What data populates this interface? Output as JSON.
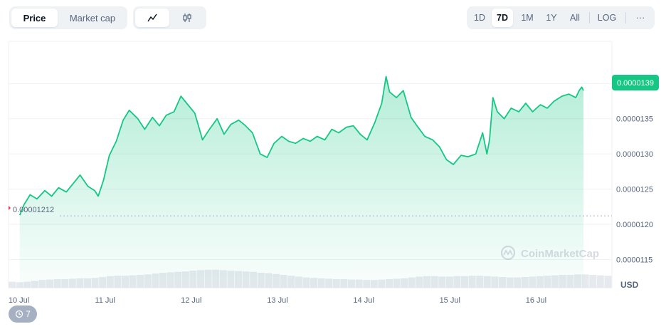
{
  "toolbar": {
    "view_tabs": [
      {
        "label": "Price",
        "active": true
      },
      {
        "label": "Market cap",
        "active": false
      }
    ],
    "chart_types": [
      {
        "icon": "line-chart-icon",
        "active": true
      },
      {
        "icon": "candlestick-icon",
        "active": false
      }
    ],
    "ranges": [
      {
        "label": "1D",
        "active": false
      },
      {
        "label": "7D",
        "active": true
      },
      {
        "label": "1M",
        "active": false
      },
      {
        "label": "1Y",
        "active": false
      },
      {
        "label": "All",
        "active": false
      }
    ],
    "log_label": "LOG",
    "more_label": "···"
  },
  "badge": {
    "icon": "history-icon",
    "count": "7"
  },
  "watermark": "CoinMarketCap",
  "colors": {
    "line": "#16c784",
    "area": "#16c784",
    "current_badge": "#16c784",
    "start_marker": "#ea3943",
    "grid": "#eff2f5"
  },
  "chart_data": {
    "type": "area",
    "currency_label": "USD",
    "x_tick_labels": [
      "10 Jul",
      "11 Jul",
      "12 Jul",
      "13 Jul",
      "14 Jul",
      "15 Jul",
      "16 Jul"
    ],
    "y_tick_labels": [
      "0.0000115",
      "0.0000120",
      "0.0000125",
      "0.0000130",
      "0.0000135"
    ],
    "y_ticks": [
      1.15e-05,
      1.2e-05,
      1.25e-05,
      1.3e-05,
      1.35e-05
    ],
    "ylim": [
      1.11e-05,
      1.46e-05
    ],
    "xlim": [
      0,
      7
    ],
    "start_value": 1.212e-05,
    "start_label": "0.00001212",
    "current_value": 1.39e-05,
    "current_label": "0.0000139",
    "grid": true,
    "series": [
      {
        "points": [
          [
            0.13,
            1.213e-05
          ],
          [
            0.18,
            1.228e-05
          ],
          [
            0.25,
            1.242e-05
          ],
          [
            0.33,
            1.236e-05
          ],
          [
            0.42,
            1.248e-05
          ],
          [
            0.5,
            1.24e-05
          ],
          [
            0.58,
            1.252e-05
          ],
          [
            0.67,
            1.246e-05
          ],
          [
            0.75,
            1.258e-05
          ],
          [
            0.83,
            1.27e-05
          ],
          [
            0.92,
            1.254e-05
          ],
          [
            1.0,
            1.248e-05
          ],
          [
            1.04,
            1.24e-05
          ],
          [
            1.1,
            1.262e-05
          ],
          [
            1.17,
            1.298e-05
          ],
          [
            1.25,
            1.318e-05
          ],
          [
            1.33,
            1.348e-05
          ],
          [
            1.4,
            1.362e-05
          ],
          [
            1.5,
            1.35e-05
          ],
          [
            1.58,
            1.335e-05
          ],
          [
            1.67,
            1.352e-05
          ],
          [
            1.75,
            1.34e-05
          ],
          [
            1.83,
            1.355e-05
          ],
          [
            1.92,
            1.36e-05
          ],
          [
            2.0,
            1.382e-05
          ],
          [
            2.08,
            1.37e-05
          ],
          [
            2.16,
            1.358e-05
          ],
          [
            2.25,
            1.32e-05
          ],
          [
            2.33,
            1.335e-05
          ],
          [
            2.42,
            1.35e-05
          ],
          [
            2.5,
            1.328e-05
          ],
          [
            2.58,
            1.342e-05
          ],
          [
            2.67,
            1.348e-05
          ],
          [
            2.75,
            1.34e-05
          ],
          [
            2.83,
            1.33e-05
          ],
          [
            2.92,
            1.3e-05
          ],
          [
            3.0,
            1.295e-05
          ],
          [
            3.08,
            1.315e-05
          ],
          [
            3.17,
            1.325e-05
          ],
          [
            3.25,
            1.318e-05
          ],
          [
            3.33,
            1.315e-05
          ],
          [
            3.42,
            1.322e-05
          ],
          [
            3.5,
            1.318e-05
          ],
          [
            3.58,
            1.325e-05
          ],
          [
            3.67,
            1.32e-05
          ],
          [
            3.75,
            1.335e-05
          ],
          [
            3.83,
            1.33e-05
          ],
          [
            3.92,
            1.338e-05
          ],
          [
            4.0,
            1.34e-05
          ],
          [
            4.08,
            1.328e-05
          ],
          [
            4.16,
            1.32e-05
          ],
          [
            4.25,
            1.345e-05
          ],
          [
            4.33,
            1.372e-05
          ],
          [
            4.38,
            1.41e-05
          ],
          [
            4.42,
            1.388e-05
          ],
          [
            4.5,
            1.38e-05
          ],
          [
            4.58,
            1.39e-05
          ],
          [
            4.67,
            1.352e-05
          ],
          [
            4.75,
            1.338e-05
          ],
          [
            4.83,
            1.325e-05
          ],
          [
            4.92,
            1.32e-05
          ],
          [
            5.0,
            1.31e-05
          ],
          [
            5.08,
            1.292e-05
          ],
          [
            5.16,
            1.285e-05
          ],
          [
            5.25,
            1.298e-05
          ],
          [
            5.33,
            1.296e-05
          ],
          [
            5.42,
            1.3e-05
          ],
          [
            5.5,
            1.33e-05
          ],
          [
            5.55,
            1.3e-05
          ],
          [
            5.58,
            1.32e-05
          ],
          [
            5.62,
            1.38e-05
          ],
          [
            5.67,
            1.36e-05
          ],
          [
            5.75,
            1.35e-05
          ],
          [
            5.83,
            1.365e-05
          ],
          [
            5.92,
            1.36e-05
          ],
          [
            6.0,
            1.372e-05
          ],
          [
            6.08,
            1.36e-05
          ],
          [
            6.17,
            1.37e-05
          ],
          [
            6.25,
            1.365e-05
          ],
          [
            6.33,
            1.375e-05
          ],
          [
            6.42,
            1.382e-05
          ],
          [
            6.5,
            1.385e-05
          ],
          [
            6.58,
            1.38e-05
          ],
          [
            6.62,
            1.39e-05
          ],
          [
            6.65,
            1.395e-05
          ],
          [
            6.67,
            1.39e-05
          ]
        ]
      }
    ],
    "volume": [
      0.14,
      0.13,
      0.14,
      0.16,
      0.18,
      0.19,
      0.2,
      0.2,
      0.21,
      0.22,
      0.22,
      0.23,
      0.25,
      0.27,
      0.28,
      0.28,
      0.29,
      0.3,
      0.31,
      0.33,
      0.35,
      0.36,
      0.37,
      0.38,
      0.4,
      0.41,
      0.42,
      0.42,
      0.41,
      0.4,
      0.39,
      0.38,
      0.37,
      0.35,
      0.34,
      0.32,
      0.3,
      0.28,
      0.26,
      0.24,
      0.23,
      0.22,
      0.21,
      0.2,
      0.2,
      0.19,
      0.19,
      0.18,
      0.18,
      0.19,
      0.2,
      0.21,
      0.22,
      0.24,
      0.26,
      0.27,
      0.27,
      0.26,
      0.26,
      0.27,
      0.27,
      0.28,
      0.28,
      0.27,
      0.26,
      0.25,
      0.24,
      0.24,
      0.25,
      0.26,
      0.27,
      0.28,
      0.29,
      0.3,
      0.3,
      0.31,
      0.31,
      0.3,
      0.29,
      0.28
    ]
  }
}
